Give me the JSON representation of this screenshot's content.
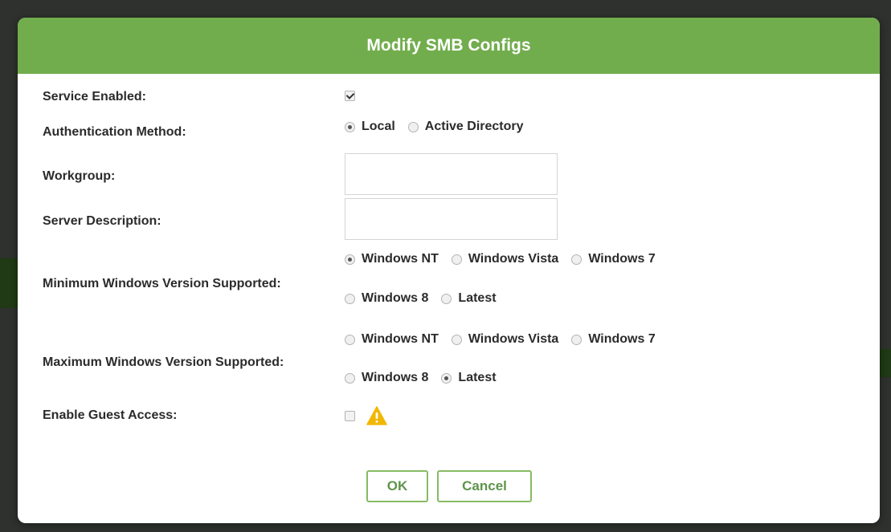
{
  "dialog": {
    "title": "Modify SMB Configs"
  },
  "fields": {
    "service_enabled": {
      "label": "Service Enabled:",
      "checked": true
    },
    "auth_method": {
      "label": "Authentication Method:",
      "options": [
        "Local",
        "Active Directory"
      ],
      "selected": "Local"
    },
    "workgroup": {
      "label": "Workgroup:",
      "value": "",
      "placeholder": ""
    },
    "server_description": {
      "label": "Server Description:",
      "value": "",
      "placeholder": ""
    },
    "min_windows": {
      "label": "Minimum Windows Version Supported:",
      "options": [
        "Windows NT",
        "Windows Vista",
        "Windows 7",
        "Windows 8",
        "Latest"
      ],
      "selected": "Windows NT"
    },
    "max_windows": {
      "label": "Maximum Windows Version Supported:",
      "options": [
        "Windows NT",
        "Windows Vista",
        "Windows 7",
        "Windows 8",
        "Latest"
      ],
      "selected": "Latest"
    },
    "guest_access": {
      "label": "Enable Guest Access:",
      "checked": false,
      "icon": "warning-icon"
    }
  },
  "buttons": {
    "ok": "OK",
    "cancel": "Cancel"
  },
  "colors": {
    "header": "#72ad4d",
    "button_border": "#86bb64",
    "button_text": "#5e944b",
    "warning": "#f2b705"
  }
}
